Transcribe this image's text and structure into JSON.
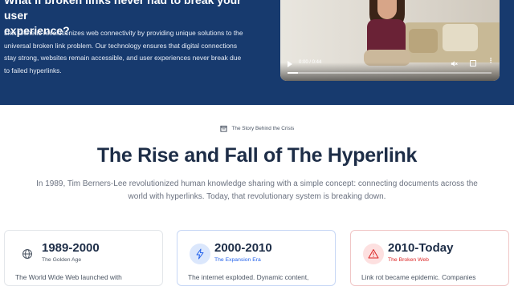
{
  "hero": {
    "title": "What if broken links never had to break your user experience?",
    "title_line1": "What if broken links never had to break your user",
    "title_line2": "experience?",
    "description": "Link Genetic revolutionizes web connectivity by providing unique solutions to the universal broken link problem. Our technology ensures that digital connections stay strong, websites remain accessible, and user experiences never break due to failed hyperlinks."
  },
  "video": {
    "time": "0:00 / 0:44",
    "progress": 0.05
  },
  "section": {
    "eyebrow": "The Story Behind the Crisis",
    "headline": "The Rise and Fall of The Hyperlink",
    "subtitle_line1": "In 1989, Tim Berners-Lee revolutionized human knowledge sharing with a simple concept: connecting documents across the",
    "subtitle_line2": "world with hyperlinks. Today, that revolutionary system is breaking down."
  },
  "cards": [
    {
      "period": "1989-2000",
      "era": "The Golden Age",
      "body": "The World Wide Web launched with",
      "icon": "globe-icon",
      "accent": "#6b7280"
    },
    {
      "period": "2000-2010",
      "era": "The Expansion Era",
      "body": "The internet exploded. Dynamic content,",
      "icon": "lightning-icon",
      "accent": "#2563eb"
    },
    {
      "period": "2010-Today",
      "era": "The Broken Web",
      "body": "Link rot became epidemic. Companies",
      "icon": "warning-icon",
      "accent": "#dc2626"
    }
  ],
  "colors": {
    "hero_bg": "#173a6e",
    "headline": "#1d2d47",
    "blue_accent": "#2563eb",
    "red_accent": "#dc2626"
  }
}
